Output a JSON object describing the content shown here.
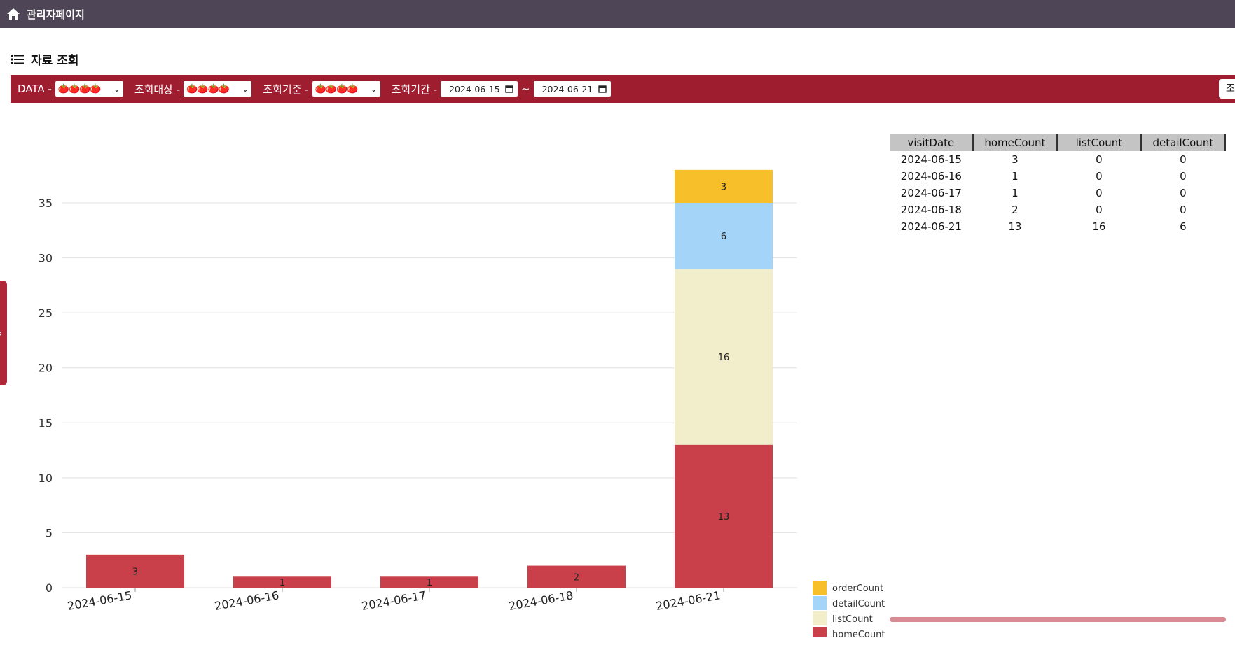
{
  "header": {
    "title": "관리자페이지",
    "home_icon": "home-icon"
  },
  "section": {
    "title": "자료 조회",
    "icon": "list-icon"
  },
  "filters": {
    "data_label": "DATA -",
    "target_label": "조회대상 -",
    "basis_label": "조회기준 -",
    "period_label": "조회기간 -",
    "select_value": "🍅🍅🍅🍅",
    "start_date": "2024-06-15",
    "end_date": "2024-06-21",
    "separator": "~",
    "search_label": "조"
  },
  "colors": {
    "header_bg": "#4e4557",
    "filter_bg": "#9e1e30",
    "homeCount": "#c9404a",
    "listCount": "#f2edca",
    "detailCount": "#a4d4f8",
    "orderCount": "#f7bf2a"
  },
  "chart_data": {
    "type": "bar",
    "stacked": true,
    "categories": [
      "2024-06-15",
      "2024-06-16",
      "2024-06-17",
      "2024-06-18",
      "2024-06-21"
    ],
    "series": [
      {
        "name": "homeCount",
        "values": [
          3,
          1,
          1,
          2,
          13
        ]
      },
      {
        "name": "listCount",
        "values": [
          0,
          0,
          0,
          0,
          16
        ]
      },
      {
        "name": "detailCount",
        "values": [
          0,
          0,
          0,
          0,
          6
        ]
      },
      {
        "name": "orderCount",
        "values": [
          0,
          0,
          0,
          0,
          3
        ]
      }
    ],
    "yticks": [
      0,
      5,
      10,
      15,
      20,
      25,
      30,
      35
    ],
    "ylim": [
      0,
      38
    ],
    "grid": true,
    "legend": "bottom-right",
    "legend_order": [
      "orderCount",
      "detailCount",
      "listCount",
      "homeCount"
    ]
  },
  "table": {
    "columns": [
      "visitDate",
      "homeCount",
      "listCount",
      "detailCount"
    ],
    "rows": [
      [
        "2024-06-15",
        "3",
        "0",
        "0"
      ],
      [
        "2024-06-16",
        "1",
        "0",
        "0"
      ],
      [
        "2024-06-17",
        "1",
        "0",
        "0"
      ],
      [
        "2024-06-18",
        "2",
        "0",
        "0"
      ],
      [
        "2024-06-21",
        "13",
        "16",
        "6"
      ]
    ]
  }
}
